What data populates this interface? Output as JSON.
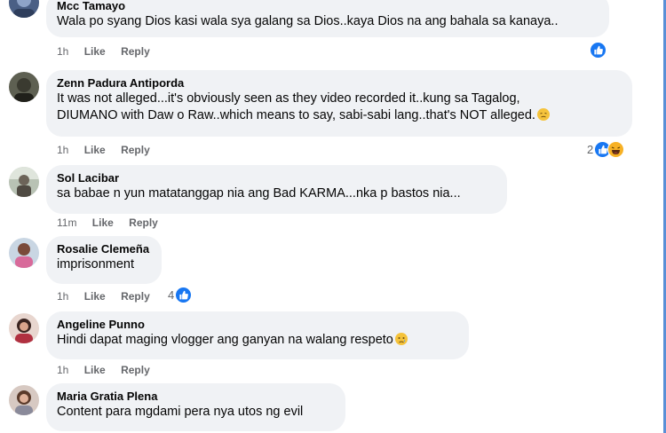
{
  "comments": [
    {
      "author": "Mcc Tamayo",
      "text": "Wala po syang Dios kasi wala sya galang sa Dios..kaya Dios na ang bahala sa kanaya..",
      "time": "1h",
      "like_label": "Like",
      "reply_label": "Reply",
      "reaction_count": ""
    },
    {
      "author": "Zenn Padura Antiporda",
      "text_line1": "It was not alleged...it's obviously seen as they video recorded it..kung sa Tagalog,",
      "text_line2": "DIUMANO with Daw o Raw..which means to say, sabi-sabi lang..that's NOT alleged.",
      "time": "1h",
      "like_label": "Like",
      "reply_label": "Reply",
      "reaction_count": "2"
    },
    {
      "author": "Sol Lacibar",
      "text": "sa babae n yun matatanggap nia ang Bad KARMA...nka p bastos nia...",
      "time": "11m",
      "like_label": "Like",
      "reply_label": "Reply"
    },
    {
      "author": "Rosalie Clemeña",
      "text": "imprisonment",
      "time": "1h",
      "like_label": "Like",
      "reply_label": "Reply",
      "reaction_count": "4"
    },
    {
      "author": "Angeline Punno",
      "text": "Hindi dapat maging vlogger ang ganyan na walang respeto",
      "time": "1h",
      "like_label": "Like",
      "reply_label": "Reply"
    },
    {
      "author": "Maria Gratia Plena",
      "text": "Content para mgdami pera nya utos ng evil"
    }
  ],
  "colors": {
    "bubble": "#f0f2f5",
    "meta": "#65676b",
    "like_blue": "#1877f2",
    "haha_yellow": "#f7b125"
  },
  "icons": {
    "like": "like-reaction-icon",
    "haha": "haha-reaction-icon",
    "sad": "sad-face-emoji"
  }
}
